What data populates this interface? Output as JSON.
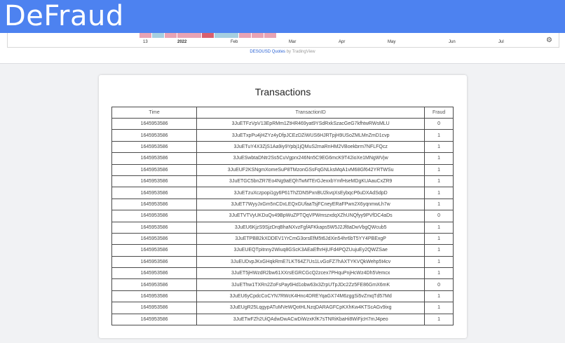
{
  "brand": {
    "title": "DeFraud"
  },
  "chart": {
    "heat_colors": [
      "#e8a3b4",
      "#a5cfe0",
      "#e8a3b4",
      "#e8a3b4",
      "#e8a3b4",
      "#d9606e",
      "#a5cfe0",
      "#a5cfe0",
      "#e8a3b4",
      "#e8a3b4",
      "#e8a3b4"
    ],
    "axis_labels": [
      "13",
      "2022",
      "Feb",
      "Mar",
      "Apr",
      "May",
      "Jun",
      "Jul"
    ],
    "settings_icon": "gear-icon",
    "attribution_link": "DESOUSD Quotes",
    "attribution_suffix": "by TradingView"
  },
  "transactions": {
    "title": "Transactions",
    "columns": [
      "Time",
      "TransactionID",
      "Fraud"
    ],
    "rows": [
      [
        "1645953586",
        "3JuETFzVpV13EpRMm1ZtHR469yat9YSdRxkSzacGeG7kfhtwRWsMLU",
        "0"
      ],
      [
        "1645953586",
        "3JuETxpPu4jHZYz4yDfpJCEzDZiWUS6HJRTpjH9USoZMLMnZmD1cvp",
        "1"
      ],
      [
        "1645953586",
        "3JuETuY4X3ZjS1Aa9iy9Ypbj1jQMuS2maRnHM2VBoekbrm7NFLFQcz",
        "1"
      ],
      [
        "1645953586",
        "3JuESwbtaDNtr2Ss5CuVgprx246Nn5C9EG6mcK9T42ioXe1MNgWVjw",
        "1"
      ],
      [
        "1645953586",
        "3JuEUF2KSNgmXomeSuP8TMzonGSsFqGNLksMqA1vM68Gf642YRTWSu",
        "1"
      ],
      [
        "1645953586",
        "3JuETGC5bnZR7Eo4Ng9aEQhTwMTErGJexxbYmfHseMDgKUAauCxZR9",
        "1"
      ],
      [
        "1645953586",
        "3JuETzuXczpopi1gy6P61ThZDN5PxnBU2kvqXsEybqcP6uDXAdSdpD",
        "1"
      ],
      [
        "1645953586",
        "3JuET7WyyJxGm5nCDxLEQxGUfaaTsjFCneyERaFPwn2X6yqnmwLh7w",
        "1"
      ],
      [
        "1645953586",
        "3JuETVTVyUKDuQv49BpWuZPTQqVPWmszxdqXZhUNQfyy9PVfDC4aDs",
        "0"
      ],
      [
        "1645953586",
        "3JuEU6KjzS9SjzDrqBhaNXvzFgfAFKkaps5W5J2Jf8aDwVbgQWcub5",
        "1"
      ],
      [
        "1645953586",
        "3JuETPBB2kXDDEV1YrCmG3orsEfM5t6JdXin54hr6bT5YY4PBExgP",
        "1"
      ],
      [
        "1645953586",
        "3JuEUEQTpitnny2Wiuq8GScK3AEaEfhrHjUFd4PQZUujuEy2QWZSae",
        "1"
      ],
      [
        "1645953586",
        "3JuEUDvpJKxGHqkRmE7LKT64Z7Us1LvGoFZ7hAXTYKVQkWehp5t4cv",
        "1"
      ],
      [
        "1645953586",
        "3JuET5jHWzdR2bw61XXrsEGRCGcQ2zcex7PHquPnjHcWz4Dh5Vemcx",
        "1"
      ],
      [
        "1645953586",
        "3JuEThw1TXRn2ZoFsPay6Hd1obw63x3ZrpUTpJDc2Zz5FE86GmX6mK",
        "0"
      ],
      [
        "1645953586",
        "3JuEU6yCpdcCoCYN7RWcK4Hnc4DREYqaGX74M6zggSi5vZmqTd57Md",
        "1"
      ],
      [
        "1645953586",
        "3JuEUgR25LqgypATuMVeWQotHLNzqDARAGFCpKXhKw4KTScAGv9ixg",
        "1"
      ],
      [
        "1645953586",
        "3JuETwFZh2UiQAdwDwACwDiWzxKfK7sTNRiKbaHi8WiFjcH7mJ4peo",
        "1"
      ]
    ]
  }
}
